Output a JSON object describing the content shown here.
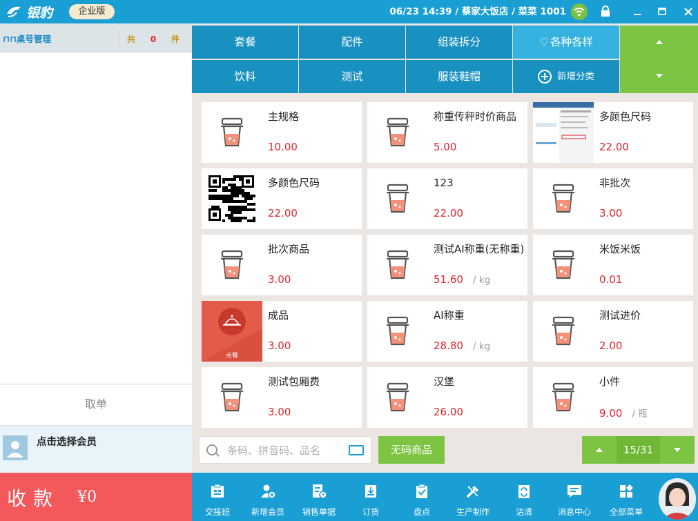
{
  "app": {
    "logo_text": "银豹",
    "edition": "企业版",
    "title_info": "06/23 14:39 / 蔡家大饭店 / 菜菜 1001"
  },
  "left_panel": {
    "title": "桌号管理",
    "count_prefix": "共",
    "count": "0",
    "count_suffix": "件",
    "cancel_label": "取单",
    "member_label": "点击选择会员"
  },
  "pay": {
    "label": "收款",
    "amount": "¥0"
  },
  "categories": [
    "套餐",
    "配件",
    "组装拆分",
    "各种各样",
    "饮料",
    "测试",
    "服装鞋帽",
    "新增分类"
  ],
  "products": [
    {
      "name": "主规格",
      "price": "10.00",
      "unit": ""
    },
    {
      "name": "称重传秤时价商品",
      "price": "5.00",
      "unit": ""
    },
    {
      "name": "多颜色尺码",
      "price": "22.00",
      "unit": ""
    },
    {
      "name": "多颜色尺码",
      "price": "22.00",
      "unit": ""
    },
    {
      "name": "123",
      "price": "22.00",
      "unit": ""
    },
    {
      "name": "非批次",
      "price": "3.00",
      "unit": ""
    },
    {
      "name": "批次商品",
      "price": "3.00",
      "unit": ""
    },
    {
      "name": "测试AI称重(无称重)",
      "price": "51.60",
      "unit": "/ kg"
    },
    {
      "name": "米饭米饭",
      "price": "0.01",
      "unit": ""
    },
    {
      "name": "成品",
      "price": "3.00",
      "unit": "",
      "thumb_label": "点餐"
    },
    {
      "name": "AI称重",
      "price": "28.80",
      "unit": "/ kg"
    },
    {
      "name": "测试进价",
      "price": "2.00",
      "unit": ""
    },
    {
      "name": "测试包厢费",
      "price": "3.00",
      "unit": ""
    },
    {
      "name": "汉堡",
      "price": "26.00",
      "unit": ""
    },
    {
      "name": "小件",
      "price": "9.00",
      "unit": "/ 瓶"
    }
  ],
  "search": {
    "placeholder": "条码、拼音码、品名"
  },
  "nocode_label": "无码商品",
  "pager": {
    "text": "15/31"
  },
  "toolbar": [
    "交接班",
    "新增会员",
    "销售单据",
    "订货",
    "盘点",
    "生产制作",
    "沽清",
    "消息中心",
    "全部菜单"
  ],
  "colors": {
    "primary": "#1a9fd4",
    "category": "#1890c0",
    "accent_green": "#7dc443",
    "price_red": "#e0262c",
    "pay_red": "#f3585b"
  }
}
